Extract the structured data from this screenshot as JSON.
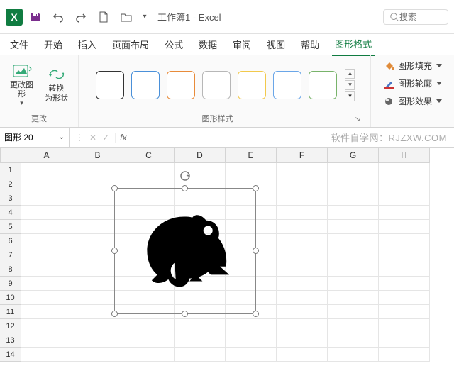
{
  "titlebar": {
    "title": "工作簿1  -  Excel",
    "search_placeholder": "搜索"
  },
  "tabs": {
    "file": "文件",
    "home": "开始",
    "insert": "插入",
    "layout": "页面布局",
    "formulas": "公式",
    "data": "数据",
    "review": "审阅",
    "view": "视图",
    "help": "帮助",
    "shape_format": "图形格式"
  },
  "ribbon": {
    "change_group_label": "更改",
    "change_shape_btn": "更改图\n形",
    "convert_shape_btn": "转换\n为形状",
    "styles_group_label": "图形样式",
    "shape_fill": "图形填充",
    "shape_outline": "图形轮廓",
    "shape_effects": "图形效果"
  },
  "namebox": {
    "value": "图形 20"
  },
  "watermark": "软件自学网：RJZXW.COM",
  "columns": [
    "A",
    "B",
    "C",
    "D",
    "E",
    "F",
    "G",
    "H"
  ],
  "rows": [
    "1",
    "2",
    "3",
    "4",
    "5",
    "6",
    "7",
    "8",
    "9",
    "10",
    "11",
    "12",
    "13",
    "14"
  ]
}
